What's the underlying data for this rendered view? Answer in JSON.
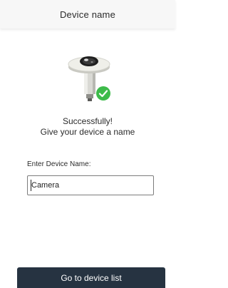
{
  "header": {
    "title": "Device name"
  },
  "illustration": {
    "icon": "camera-device-icon",
    "badge_icon": "checkmark-icon",
    "badge_color": "#3dbb4a"
  },
  "message": {
    "line1": "Successfully!",
    "line2": "Give your device a name"
  },
  "form": {
    "label": "Enter Device Name:",
    "value": "Camera"
  },
  "footer": {
    "button_label": "Go to device list",
    "button_color": "#263341"
  }
}
